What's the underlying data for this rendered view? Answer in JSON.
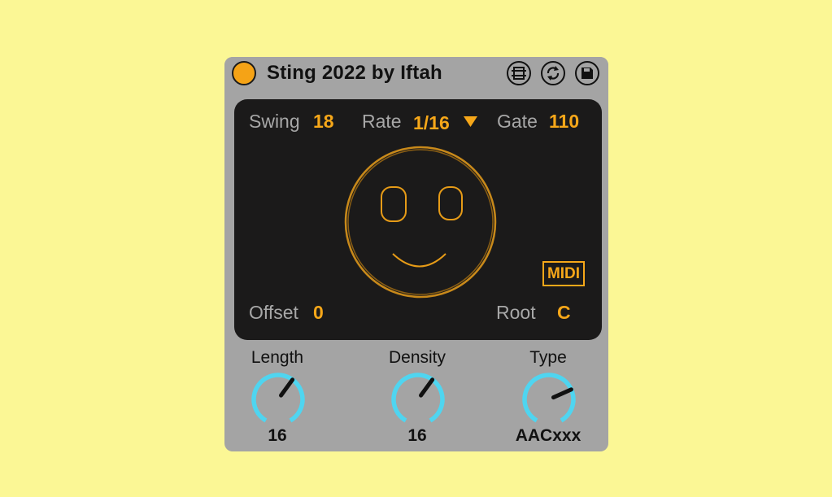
{
  "device": {
    "title": "Sting 2022 by Iftah",
    "buttons": [
      "hot-swap-icon",
      "refresh-icon",
      "save-icon"
    ]
  },
  "panel": {
    "swing": {
      "label": "Swing",
      "value": "18"
    },
    "rate": {
      "label": "Rate",
      "value": "1/16"
    },
    "gate": {
      "label": "Gate",
      "value": "110"
    },
    "offset": {
      "label": "Offset",
      "value": "0"
    },
    "root": {
      "label": "Root",
      "value": "C"
    },
    "midi": "MIDI"
  },
  "knobs": [
    {
      "label": "Length",
      "value": "16",
      "level": 0.62
    },
    {
      "label": "Density",
      "value": "16",
      "level": 0.62
    },
    {
      "label": "Type",
      "value": "AACxxx",
      "level": 0.72
    }
  ],
  "colors": {
    "background": "#fbf795",
    "device": "#a4a4a4",
    "panel": "#1b1a1a",
    "accent": "#f6a719",
    "knob_arc": "#4fd5f0"
  }
}
